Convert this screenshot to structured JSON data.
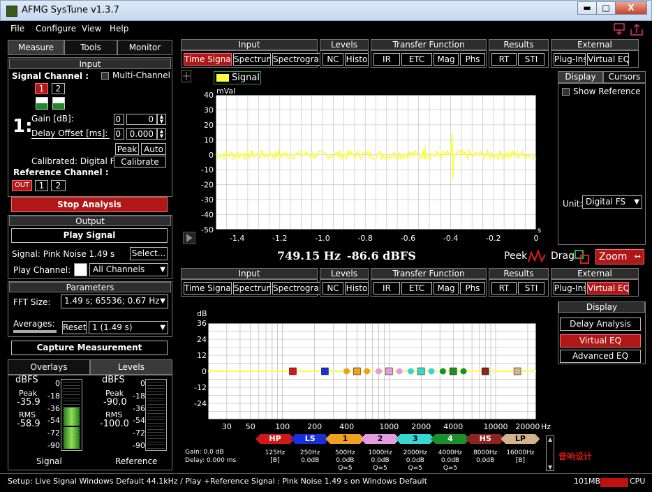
{
  "window": {
    "title": "AFMG SysTune v1.3.7",
    "min": "▬",
    "max": "□",
    "close": "X"
  },
  "menu": [
    "File",
    "Configure",
    "View",
    "Help"
  ],
  "left": {
    "tabs": [
      "Measure",
      "Tools",
      "Monitor"
    ],
    "input": {
      "header": "Input",
      "signal_channel": "Signal Channel :",
      "multi_channel": "Multi-Channel",
      "ch1": "1",
      "ch2": "2",
      "big_num": "1:",
      "gain_label": "Gain [dB]:",
      "gain_a": "0",
      "gain_b": "0",
      "delay_label": "Delay Offset [ms]:",
      "delay_a": "0",
      "delay_b": "0.000",
      "peak": "Peak",
      "auto": "Auto",
      "calibrated": "Calibrated: Digital FS",
      "calibrate": "Calibrate",
      "ref_channel": "Reference Channel :",
      "ref_out": "OUT",
      "ref1": "1",
      "ref2": "2"
    },
    "stop_analysis": "Stop Analysis",
    "output": {
      "header": "Output",
      "play_signal": "Play Signal",
      "signal": "Signal: Pink Noise  1.49 s",
      "select": "Select...",
      "play_channel": "Play Channel:",
      "all_channels": "All Channels"
    },
    "parameters": {
      "header": "Parameters",
      "fft_label": "FFT Size:",
      "fft_value": "1.49 s; 65536; 0.67 Hz",
      "averages": "Averages:",
      "reset": "Reset",
      "avg_value": "1 (1.49 s)"
    },
    "capture": "Capture Measurement",
    "bottom_tabs": [
      "Overlays",
      "Levels"
    ],
    "levels": {
      "left": {
        "unit": "dBFS",
        "peak_label": "Peak",
        "peak": "-35.9",
        "rms_label": "RMS",
        "rms": "-58.9",
        "name": "Signal",
        "fill_db": -58.9
      },
      "right": {
        "unit": "dBFS",
        "peak_label": "Peak",
        "peak": "-90.0",
        "rms_label": "RMS",
        "rms": "-100.0",
        "name": "Reference"
      },
      "scale": [
        "0",
        "-18",
        "-36",
        "-54",
        "-72",
        "-90"
      ]
    }
  },
  "toolbar": {
    "groups": [
      {
        "title": "Input",
        "buttons": [
          "Time Signal",
          "Spectrum",
          "Spectrogram"
        ]
      },
      {
        "title": "Levels",
        "buttons": [
          "NC",
          "Histo"
        ]
      },
      {
        "title": "Transfer Function",
        "buttons": [
          "IR",
          "ETC",
          "Mag",
          "Phs"
        ]
      },
      {
        "title": "Results",
        "buttons": [
          "RT",
          "STI"
        ]
      },
      {
        "title": "External",
        "buttons": [
          "Plug-Ins",
          "Virtual EQ"
        ]
      }
    ]
  },
  "top_chart": {
    "legend": "Signal",
    "readout_freq": "749.15 Hz",
    "readout_level": "-86.6 dBFS",
    "peek": "Peek",
    "drag": "Drag",
    "zoom": "Zoom",
    "right_tabs": [
      "Display",
      "Cursors"
    ],
    "show_reference": "Show Reference",
    "unit_label": "Unit:",
    "unit_value": "Digital FS"
  },
  "bottom_chart": {
    "right_header": "Display",
    "buttons": [
      "Delay Analysis",
      "Virtual EQ",
      "Advanced EQ"
    ],
    "gain": "Gain: 0.0 dB",
    "delay": "Delay: 0.000 ms",
    "bands": [
      {
        "label": "HP",
        "color": "#d01818",
        "freq": "125Hz",
        "gain": "[B]",
        "q": ""
      },
      {
        "label": "LS",
        "color": "#1b2fd8",
        "freq": "250Hz",
        "gain": "0.0dB",
        "q": ""
      },
      {
        "label": "1",
        "color": "#f0a020",
        "freq": "500Hz",
        "gain": "0.0dB",
        "q": "Q=5"
      },
      {
        "label": "2",
        "color": "#e69be0",
        "freq": "1000Hz",
        "gain": "0.0dB",
        "q": "Q=5"
      },
      {
        "label": "3",
        "color": "#38d6d0",
        "freq": "2000Hz",
        "gain": "0.0dB",
        "q": "Q=5"
      },
      {
        "label": "4",
        "color": "#1a8f2a",
        "freq": "4000Hz",
        "gain": "0.0dB",
        "q": "Q=5"
      },
      {
        "label": "HS",
        "color": "#8c2424",
        "freq": "8000Hz",
        "gain": "0.0dB",
        "q": ""
      },
      {
        "label": "LP",
        "color": "#d2b48c",
        "freq": "16000Hz",
        "gain": "[B]",
        "q": ""
      }
    ]
  },
  "status": {
    "text": "Setup: Live Signal Windows Default 44.1kHz / Play +Reference Signal : Pink Noise  1.49 s on Windows Default",
    "mem": "101MB",
    "cpu": "CPU"
  },
  "watermark": "音响设计",
  "chart_data": [
    {
      "type": "line",
      "ylabel": "mVal",
      "xlabel": "s",
      "xlim": [
        -1.5,
        0
      ],
      "ylim": [
        -50,
        40
      ],
      "xticks": [
        "-1.4",
        "-1.2",
        "-1.0",
        "-0.8",
        "-0.6",
        "-0.4",
        "-0.2",
        "0"
      ],
      "xtick_values": [
        -1.4,
        -1.2,
        -1.0,
        -0.8,
        -0.6,
        -0.4,
        -0.2,
        0
      ],
      "yticks": [
        "40",
        "30",
        "20",
        "10",
        "0",
        "-10",
        "-20",
        "-30",
        "-40",
        "-50"
      ],
      "series": [
        {
          "name": "Signal",
          "color": "#ffff40",
          "noise_amplitude": 3,
          "spikes": [
            {
              "x": -0.52,
              "y": 6
            },
            {
              "x": -0.395,
              "y": 14
            },
            {
              "x": -0.39,
              "y": -16
            }
          ]
        }
      ]
    },
    {
      "type": "scatter",
      "ylabel": "dB",
      "xlabel": "Hz",
      "xscale": "log",
      "xlim": [
        20,
        24000
      ],
      "ylim": [
        -36,
        36
      ],
      "xticks": [
        "30",
        "50",
        "100",
        "200",
        "400",
        "1000",
        "2000",
        "4000",
        "10000",
        "20000"
      ],
      "xtick_values": [
        30,
        50,
        100,
        200,
        400,
        1000,
        2000,
        4000,
        10000,
        20000
      ],
      "yticks": [
        "36",
        "24",
        "12",
        "0",
        "-12",
        "-24"
      ],
      "ytick_values": [
        36,
        24,
        12,
        0,
        -12,
        -24
      ],
      "curve": {
        "color": "#ffff40",
        "value": 0
      },
      "markers": [
        {
          "x": 125,
          "y": 0,
          "color": "#d01818",
          "shape": "square"
        },
        {
          "x": 250,
          "y": 0,
          "color": "#1b2fd8",
          "shape": "square"
        },
        {
          "x": 400,
          "y": 0,
          "color": "#f0a020",
          "shape": "circle"
        },
        {
          "x": 500,
          "y": 0,
          "color": "#f0a020",
          "shape": "square"
        },
        {
          "x": 620,
          "y": 0,
          "color": "#f0a020",
          "shape": "circle"
        },
        {
          "x": 800,
          "y": 0,
          "color": "#e69be0",
          "shape": "circle"
        },
        {
          "x": 1000,
          "y": 0,
          "color": "#e69be0",
          "shape": "square"
        },
        {
          "x": 1250,
          "y": 0,
          "color": "#e69be0",
          "shape": "circle"
        },
        {
          "x": 1600,
          "y": 0,
          "color": "#38d6d0",
          "shape": "circle"
        },
        {
          "x": 2000,
          "y": 0,
          "color": "#38d6d0",
          "shape": "square"
        },
        {
          "x": 2500,
          "y": 0,
          "color": "#38d6d0",
          "shape": "circle"
        },
        {
          "x": 3200,
          "y": 0,
          "color": "#1a8f2a",
          "shape": "circle"
        },
        {
          "x": 4000,
          "y": 0,
          "color": "#1a8f2a",
          "shape": "square"
        },
        {
          "x": 5000,
          "y": 0,
          "color": "#1a8f2a",
          "shape": "circle"
        },
        {
          "x": 8000,
          "y": 0,
          "color": "#8c2424",
          "shape": "square"
        },
        {
          "x": 16000,
          "y": 0,
          "color": "#d2b48c",
          "shape": "square"
        }
      ]
    }
  ]
}
